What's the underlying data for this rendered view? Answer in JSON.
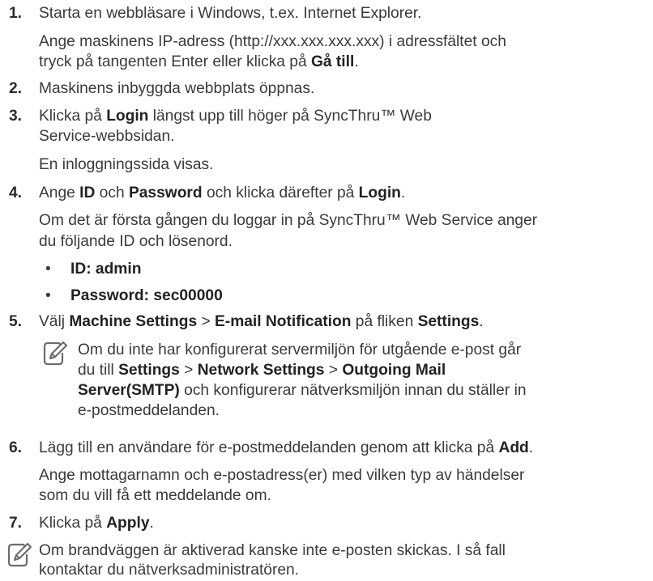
{
  "steps": [
    {
      "num": "1.",
      "l1": "Starta en webbläsare i Windows, t.ex. Internet Explorer.",
      "l2": "Ange maskinens IP-adress (http://xxx.xxx.xxx.xxx) i adressfältet och",
      "l3a": "tryck på tangenten Enter eller klicka på ",
      "l3b": "Gå till",
      "l3c": "."
    },
    {
      "num": "2.",
      "l1": "Maskinens inbyggda webbplats öppnas."
    },
    {
      "num": "3.",
      "l1a": "Klicka på ",
      "l1b": "Login",
      "l1c": " längst upp till höger på SyncThru™ Web",
      "l2": "Service-webbsidan.",
      "l3": "En inloggningssida visas."
    },
    {
      "num": "4.",
      "l1a": "Ange ",
      "l1b": "ID",
      "l1c": " och ",
      "l1d": "Password",
      "l1e": " och klicka därefter på ",
      "l1f": "Login",
      "l1g": ".",
      "l2": "Om det är första gången du loggar in på SyncThru™ Web Service anger",
      "l3": "du följande ID och lösenord.",
      "b1": "ID:  admin",
      "b2": "Password:  sec00000",
      "bullet": "•"
    },
    {
      "num": "5.",
      "l1a": "Välj ",
      "l1b": "Machine Settings",
      "l1c": " > ",
      "l1d": "E-mail Notification",
      "l1e": " på fliken ",
      "l1f": "Settings",
      "l1g": ".",
      "n1": "Om du inte har konfigurerat servermiljön för utgående e-post går",
      "n2a": "du till ",
      "n2b": "Settings",
      "n2c": " > ",
      "n2d": "Network Settings",
      "n2e": " > ",
      "n2f": "Outgoing Mail",
      "n3a": "Server(SMTP)",
      "n3b": " och konfigurerar nätverksmiljön innan du ställer in",
      "n4": "e-postmeddelanden."
    },
    {
      "num": "6.",
      "l1a": "Lägg till en användare för e-postmeddelanden genom att klicka på ",
      "l1b": "Add",
      "l1c": ".",
      "l2": "Ange mottagarnamn och e-postadress(er) med vilken typ av händelser",
      "l3": "som du vill få ett meddelande om."
    },
    {
      "num": "7.",
      "l1a": "Klicka på ",
      "l1b": "Apply",
      "l1c": "."
    }
  ],
  "final_note": {
    "l1": "Om brandväggen är aktiverad kanske inte e-posten skickas. I så fall",
    "l2": "kontaktar du nätverksadministratören."
  },
  "icon": "note-pencil-icon"
}
